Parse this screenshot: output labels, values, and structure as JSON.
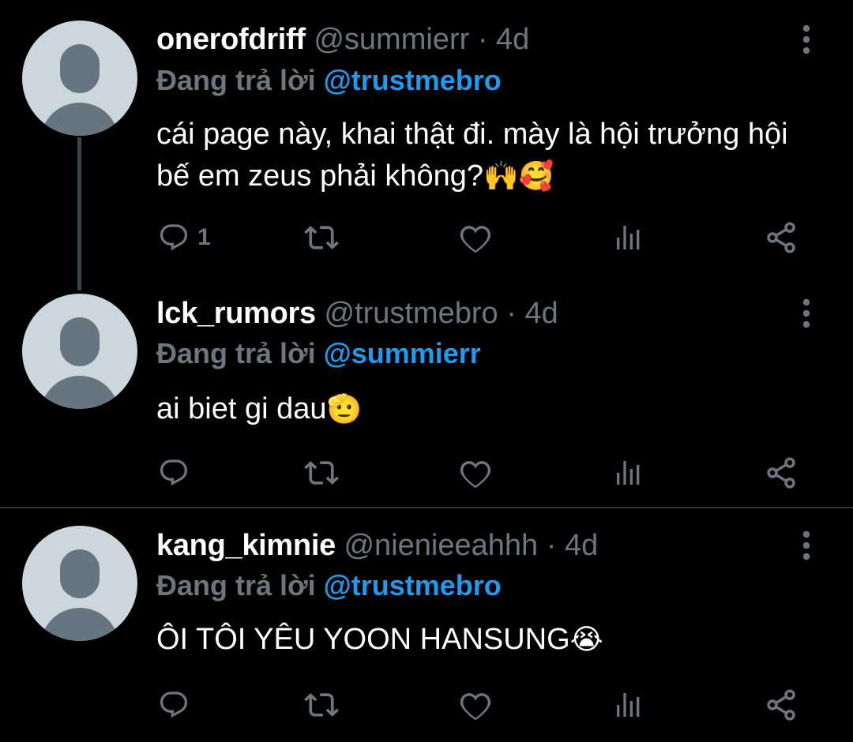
{
  "colors": {
    "background": "#000000",
    "text_primary": "#ffffff",
    "text_secondary": "#6e767d",
    "mention_blue": "#1d9bf0",
    "avatar_bg": "#ccd6dd",
    "avatar_fg": "#66757f"
  },
  "tweets": [
    {
      "display_name": "onerofdriff",
      "handle": "@summierr",
      "separator": "·",
      "time": "4d",
      "reply_prefix": "Đang trả lời",
      "reply_to": "@trustmebro",
      "text": "cái page này, khai thật đi. mày là hội trưởng hội bế em zeus phải không?",
      "emojis": "🙌🥰",
      "reply_count": "1",
      "icons": [
        "reply-icon",
        "retweet-icon",
        "like-icon",
        "analytics-icon",
        "share-icon",
        "more-icon"
      ]
    },
    {
      "display_name": "lck_rumors",
      "handle": "@trustmebro",
      "separator": "·",
      "time": "4d",
      "reply_prefix": "Đang trả lời",
      "reply_to": "@summierr",
      "text": "ai biet gi dau",
      "emojis": "🫡",
      "reply_count": "",
      "icons": [
        "reply-icon",
        "retweet-icon",
        "like-icon",
        "analytics-icon",
        "share-icon",
        "more-icon"
      ]
    },
    {
      "display_name": "kang_kimnie",
      "handle": "@nienieeahhh",
      "separator": "·",
      "time": "4d",
      "reply_prefix": "Đang trả lời",
      "reply_to": "@trustmebro",
      "text": "ÔI TÔI YÊU YOON HANSUNG",
      "emojis": "😭",
      "reply_count": "",
      "icons": [
        "reply-icon",
        "retweet-icon",
        "like-icon",
        "analytics-icon",
        "share-icon",
        "more-icon"
      ]
    }
  ]
}
